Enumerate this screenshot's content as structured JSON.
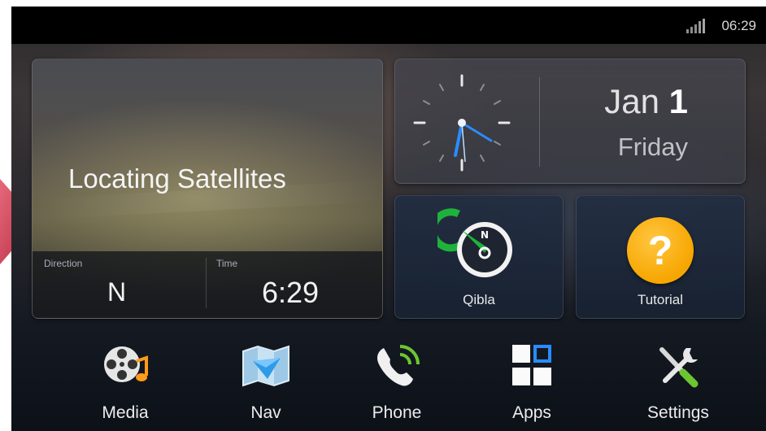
{
  "status": {
    "time": "06:29",
    "signal_icon": "signal-bars-icon"
  },
  "nav_panel": {
    "title": "Locating Satellites",
    "direction_label": "Direction",
    "direction_value": "N",
    "time_label": "Time",
    "time_value": "6:29"
  },
  "date_panel": {
    "month": "Jan",
    "day": "1",
    "weekday": "Friday"
  },
  "tiles": {
    "qibla": {
      "label": "Qibla",
      "icon": "compass-icon"
    },
    "tutorial": {
      "label": "Tutorial",
      "icon": "question-icon",
      "glyph": "?"
    }
  },
  "dock": [
    {
      "label": "Media",
      "icon": "film-reel-icon"
    },
    {
      "label": "Nav",
      "icon": "map-icon"
    },
    {
      "label": "Phone",
      "icon": "phone-icon"
    },
    {
      "label": "Apps",
      "icon": "apps-grid-icon"
    },
    {
      "label": "Settings",
      "icon": "tools-icon"
    }
  ],
  "colors": {
    "accent_blue": "#2a8cff",
    "tutorial_orange": "#f7a600",
    "arrow_pink": "#d44459",
    "qibla_green": "#1fb23b"
  }
}
